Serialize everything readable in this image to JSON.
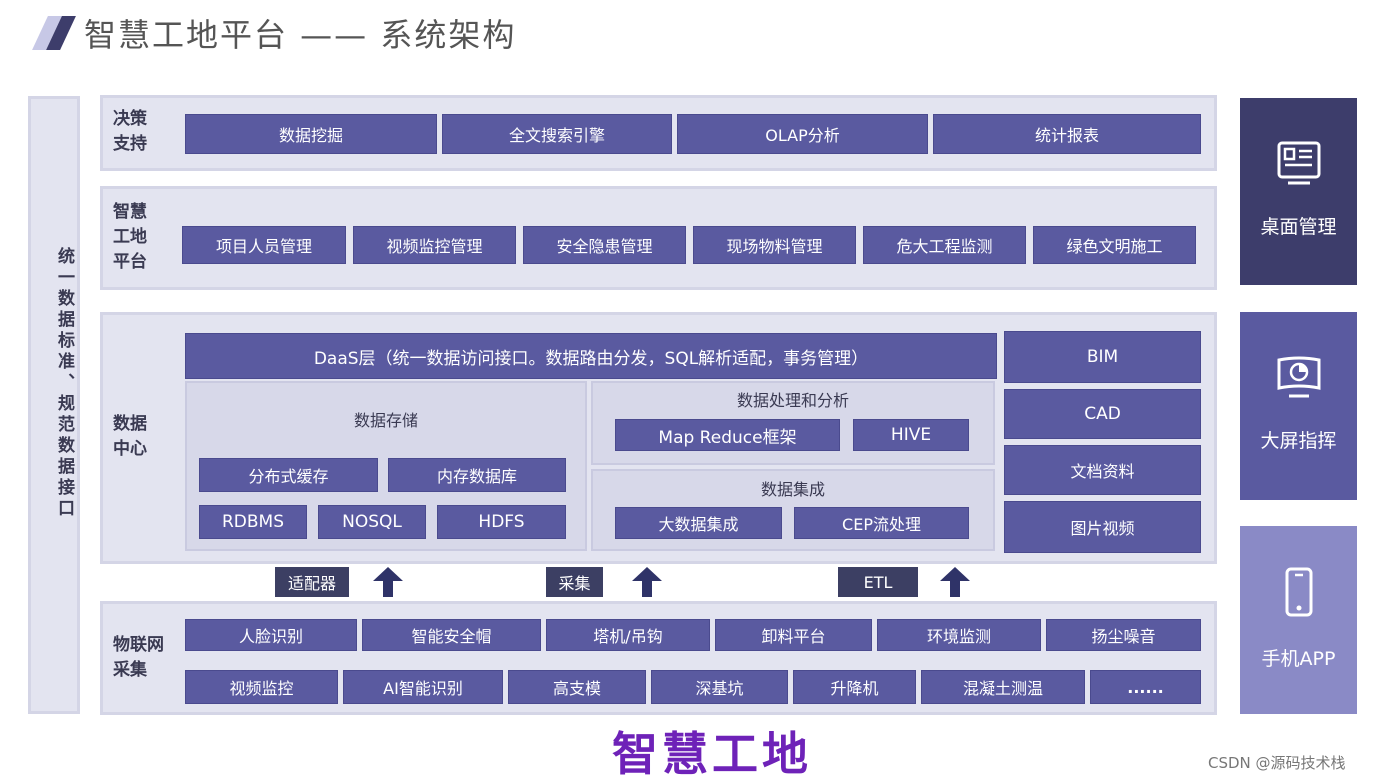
{
  "header": {
    "title": "智慧工地平台 —— 系统架构"
  },
  "left_label": "统一数据标准、规范数据接口",
  "decision": {
    "label": "决策支持",
    "items": [
      "数据挖掘",
      "全文搜索引擎",
      "OLAP分析",
      "统计报表"
    ]
  },
  "platform": {
    "label": "智慧工地平台",
    "items": [
      "项目人员管理",
      "视频监控管理",
      "安全隐患管理",
      "现场物料管理",
      "危大工程监测",
      "绿色文明施工"
    ]
  },
  "datacenter": {
    "label": "数据中心",
    "daas": "DaaS层（统一数据访问接口。数据路由分发，SQL解析适配，事务管理）",
    "storage": {
      "title": "数据存储",
      "items": [
        "分布式缓存",
        "内存数据库",
        "RDBMS",
        "NOSQL",
        "HDFS"
      ]
    },
    "processing": {
      "title": "数据处理和分析",
      "items": [
        "Map Reduce框架",
        "HIVE"
      ]
    },
    "integration": {
      "title": "数据集成",
      "items": [
        "大数据集成",
        "CEP流处理"
      ]
    },
    "resources": [
      "BIM",
      "CAD",
      "文档资料",
      "图片视频"
    ]
  },
  "adapters": [
    "适配器",
    "采集",
    "ETL"
  ],
  "iot": {
    "label": "物联网采集",
    "row1": [
      "人脸识别",
      "智能安全帽",
      "塔机/吊钩",
      "卸料平台",
      "环境监测",
      "扬尘噪音"
    ],
    "row2": [
      "视频监控",
      "AI智能识别",
      "高支模",
      "深基坑",
      "升降机",
      "混凝土测温",
      "......"
    ]
  },
  "right_panels": [
    {
      "label": "桌面管理",
      "icon": "desktop-icon",
      "color": "#3d3d6b"
    },
    {
      "label": "大屏指挥",
      "icon": "big-screen-icon",
      "color": "#5a5aa0"
    },
    {
      "label": "手机APP",
      "icon": "mobile-phone-icon",
      "color": "#8a8ac6"
    }
  ],
  "footer": {
    "title": "智慧工地"
  },
  "watermark": "CSDN @源码技术栈",
  "colors": {
    "module": "#5a5aa0",
    "panel": "#e3e4f0",
    "adapter": "#3c3f63",
    "arrow": "#2f3368",
    "footer": "#6e22b8"
  }
}
